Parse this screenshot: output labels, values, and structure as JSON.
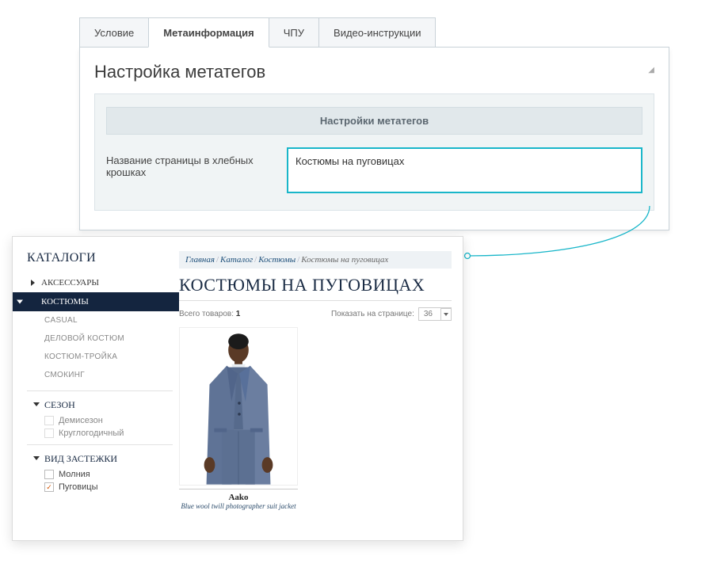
{
  "admin": {
    "tabs": [
      "Условие",
      "Метаинформация",
      "ЧПУ",
      "Видео-инструкции"
    ],
    "active_tab_index": 1,
    "panel_title": "Настройка метатегов",
    "section_title": "Настройки метатегов",
    "field_label": "Название страницы в хлебных крошках",
    "field_value": "Костюмы на пуговицах"
  },
  "store": {
    "sidebar_title": "КАТАЛОГИ",
    "top_categories": [
      "АКСЕССУАРЫ",
      "КОСТЮМЫ"
    ],
    "active_top_index": 1,
    "subcats": [
      "CASUAL",
      "ДЕЛОВОЙ КОСТЮМ",
      "КОСТЮМ-ТРОЙКА",
      "СМОКИНГ"
    ],
    "facets": [
      {
        "title": "СЕЗОН",
        "options": [
          {
            "label": "Демисезон",
            "enabled": false,
            "checked": false
          },
          {
            "label": "Круглогодичный",
            "enabled": false,
            "checked": false
          }
        ]
      },
      {
        "title": "ВИД ЗАСТЕЖКИ",
        "options": [
          {
            "label": "Молния",
            "enabled": true,
            "checked": false
          },
          {
            "label": "Пуговицы",
            "enabled": true,
            "checked": true
          }
        ]
      }
    ],
    "breadcrumb": [
      "Главная",
      "Каталог",
      "Костюмы",
      "Костюмы на пуговицах"
    ],
    "heading": "КОСТЮМЫ НА ПУГОВИЦАХ",
    "total_label": "Всего товаров:",
    "total_value": "1",
    "per_page_label": "Показать на странице:",
    "per_page_value": "36",
    "product": {
      "brand": "Aako",
      "desc": "Blue wool twill photographer suit jacket"
    }
  }
}
